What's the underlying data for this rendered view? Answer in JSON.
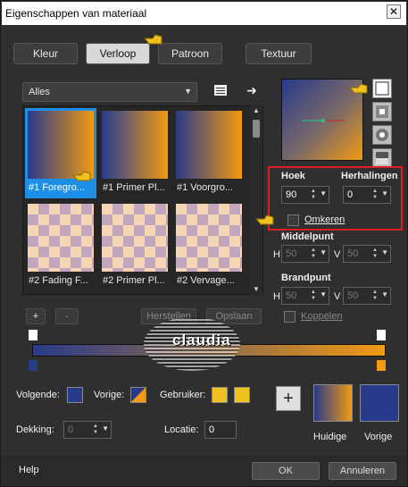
{
  "window": {
    "title": "Eigenschappen van materiaal",
    "close_label": "✕"
  },
  "tabs": [
    {
      "label": "Kleur",
      "active": false
    },
    {
      "label": "Verloop",
      "active": true
    },
    {
      "label": "Patroon",
      "active": false
    },
    {
      "label": "Textuur",
      "active": false
    }
  ],
  "gradient_list": {
    "category": "Alles",
    "items": [
      {
        "label": "#1 Foregro...",
        "type": "blue-orange",
        "selected": true
      },
      {
        "label": "#1 Primer Pl...",
        "type": "blue-orange-mid",
        "selected": false
      },
      {
        "label": "#1 Voorgro...",
        "type": "blue-orange-mid2",
        "selected": false
      },
      {
        "label": "#2 Fading F...",
        "type": "checker-fade",
        "selected": false
      },
      {
        "label": "#2 Primer Pl...",
        "type": "checker-fade",
        "selected": false
      },
      {
        "label": "#2 Vervage...",
        "type": "checker-fade",
        "selected": false
      }
    ]
  },
  "list_buttons": {
    "add": "+",
    "remove": "-",
    "reset": "Herstellen",
    "save": "Opslaan"
  },
  "settings": {
    "angle_label": "Hoek",
    "angle_value": "90",
    "repeats_label": "Herhalingen",
    "repeats_value": "0",
    "invert_label": "Omkeren",
    "midpoint_label": "Middelpunt",
    "midpoint_h_label": "H",
    "midpoint_h_value": "50",
    "midpoint_v_label": "V",
    "midpoint_v_value": "50",
    "focal_label": "Brandpunt",
    "focal_h_label": "H",
    "focal_h_value": "50",
    "focal_v_label": "V",
    "focal_v_value": "50",
    "link_label": "Koppelen"
  },
  "watermark": {
    "text": "claudia"
  },
  "bottom": {
    "next_label": "Volgende:",
    "prev_label": "Vorige:",
    "user_label": "Gebruiker:",
    "opacity_label": "Dekking:",
    "opacity_value": "0",
    "location_label": "Locatie:",
    "location_value": "0",
    "current_label": "Huidige",
    "previous_label": "Vorige"
  },
  "footer": {
    "help": "Help",
    "ok": "OK",
    "cancel": "Annuleren"
  },
  "colors": {
    "blue": "#283a8a",
    "orange": "#f39a10",
    "accent_red": "#e01c24",
    "selected_blue": "#1e8fe6",
    "yellow": "#f0c020"
  },
  "icons": [
    "close-icon",
    "list-view-icon",
    "arrow-right-icon",
    "pointer-hand-icon",
    "style-linear-icon",
    "style-rectangular-icon",
    "style-sunburst-icon",
    "style-radial-icon",
    "plus-icon"
  ]
}
